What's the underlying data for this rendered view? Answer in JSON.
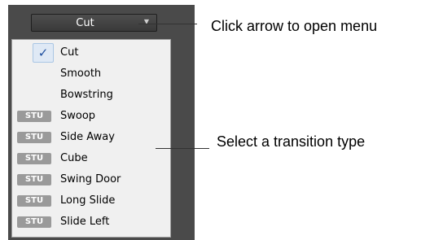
{
  "dropdown": {
    "label": "Cut",
    "arrow_icon": "triangle-down"
  },
  "menu": {
    "items": [
      {
        "label": "Cut",
        "checked": true,
        "badge": ""
      },
      {
        "label": "Smooth",
        "checked": false,
        "badge": ""
      },
      {
        "label": "Bowstring",
        "checked": false,
        "badge": ""
      },
      {
        "label": "Swoop",
        "checked": false,
        "badge": "STU"
      },
      {
        "label": "Side Away",
        "checked": false,
        "badge": "STU"
      },
      {
        "label": "Cube",
        "checked": false,
        "badge": "STU"
      },
      {
        "label": "Swing Door",
        "checked": false,
        "badge": "STU"
      },
      {
        "label": "Long Slide",
        "checked": false,
        "badge": "STU"
      },
      {
        "label": "Slide Left",
        "checked": false,
        "badge": "STU"
      }
    ]
  },
  "callouts": {
    "open_menu": "Click arrow to open menu",
    "select_type": "Select a transition type"
  },
  "colors": {
    "panel_bg": "#4a4a4a",
    "menu_bg": "#f0f0f0",
    "badge_bg": "#9a9a9a",
    "check_color": "#1f4f9f"
  }
}
